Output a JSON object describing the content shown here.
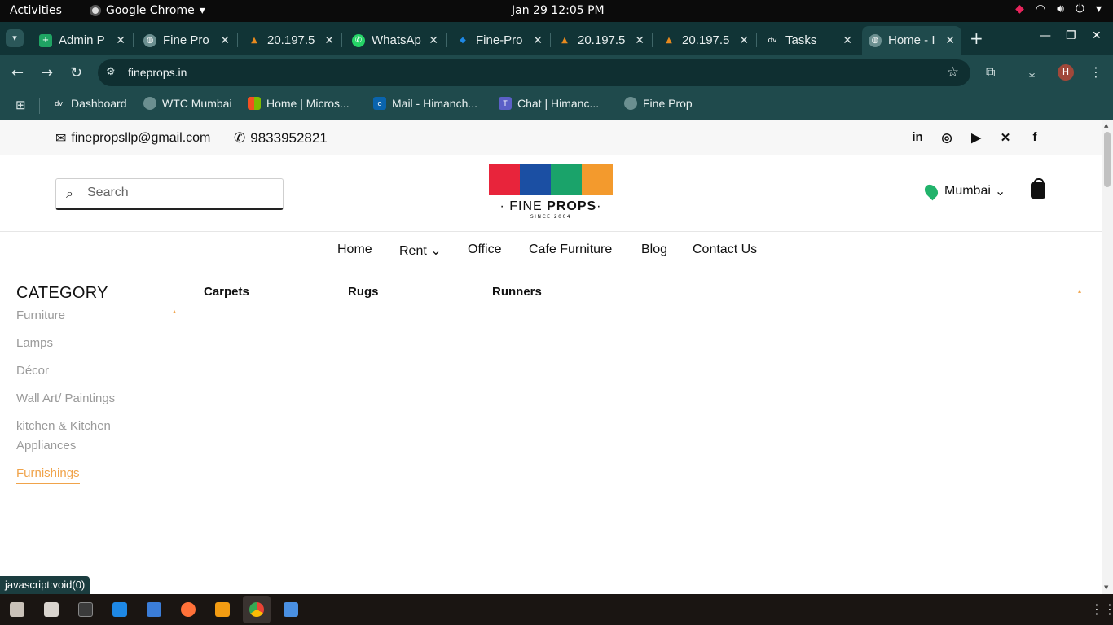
{
  "system": {
    "activities": "Activities",
    "app_name": "Google Chrome",
    "clock": "Jan 29  12:05 PM"
  },
  "tabs": [
    {
      "title": "Admin P",
      "favicon": "sheets-icon",
      "color": "#1fa463"
    },
    {
      "title": "Fine Pro",
      "favicon": "globe-icon",
      "color": "#6b8f90"
    },
    {
      "title": "20.197.5",
      "favicon": "hexagon-icon",
      "color": "#e88a1e"
    },
    {
      "title": "WhatsAp",
      "favicon": "whatsapp-icon",
      "color": "#25d366"
    },
    {
      "title": "Fine-Pro",
      "favicon": "diamond-icon",
      "color": "#1e88e5"
    },
    {
      "title": "20.197.5",
      "favicon": "hexagon-icon",
      "color": "#e88a1e"
    },
    {
      "title": "20.197.5",
      "favicon": "hexagon-icon",
      "color": "#e88a1e"
    },
    {
      "title": "Tasks",
      "favicon": "dv-icon",
      "color": "#444444"
    },
    {
      "title": "Home - I",
      "favicon": "globe-icon",
      "color": "#6b8f90"
    }
  ],
  "omnibox": {
    "url": "fineprops.in"
  },
  "profile_initial": "H",
  "bookmarks": [
    {
      "label": "Dashboard",
      "icon": "dv-icon"
    },
    {
      "label": "WTC Mumbai",
      "icon": "globe-icon"
    },
    {
      "label": "Home | Micros...",
      "icon": "microsoft-icon"
    },
    {
      "label": "Mail - Himanch...",
      "icon": "outlook-icon"
    },
    {
      "label": "Chat | Himanc...",
      "icon": "teams-icon"
    },
    {
      "label": "Fine Prop",
      "icon": "globe-icon"
    }
  ],
  "site": {
    "email": "finepropsllp@gmail.com",
    "phone": "9833952821",
    "search_placeholder": "Search",
    "logo_brand_light": "· FINE ",
    "logo_brand_bold": "PROPS",
    "logo_brand_dot": "·",
    "logo_since": "SINCE 2004",
    "logo_colors": [
      "#e8243b",
      "#1b4fa3",
      "#1aa36a",
      "#f39a2d"
    ],
    "location": "Mumbai",
    "nav": [
      "Home",
      "Rent",
      "Office",
      "Cafe Furniture",
      "Blog",
      "Contact Us"
    ],
    "category_title": "CATEGORY",
    "categories": [
      {
        "label": "Furniture",
        "active": false
      },
      {
        "label": "Lamps",
        "active": false
      },
      {
        "label": "Décor",
        "active": false
      },
      {
        "label": "Wall Art/ Paintings",
        "active": false
      },
      {
        "label": "kitchen & Kitchen",
        "active": false
      },
      {
        "label": "Appliances",
        "active": false
      },
      {
        "label": "Furnishings",
        "active": true
      }
    ],
    "subcategories": [
      "Carpets",
      "Rugs",
      "Runners"
    ],
    "accent_color": "#f0a34a"
  },
  "status_text": "javascript:void(0)"
}
